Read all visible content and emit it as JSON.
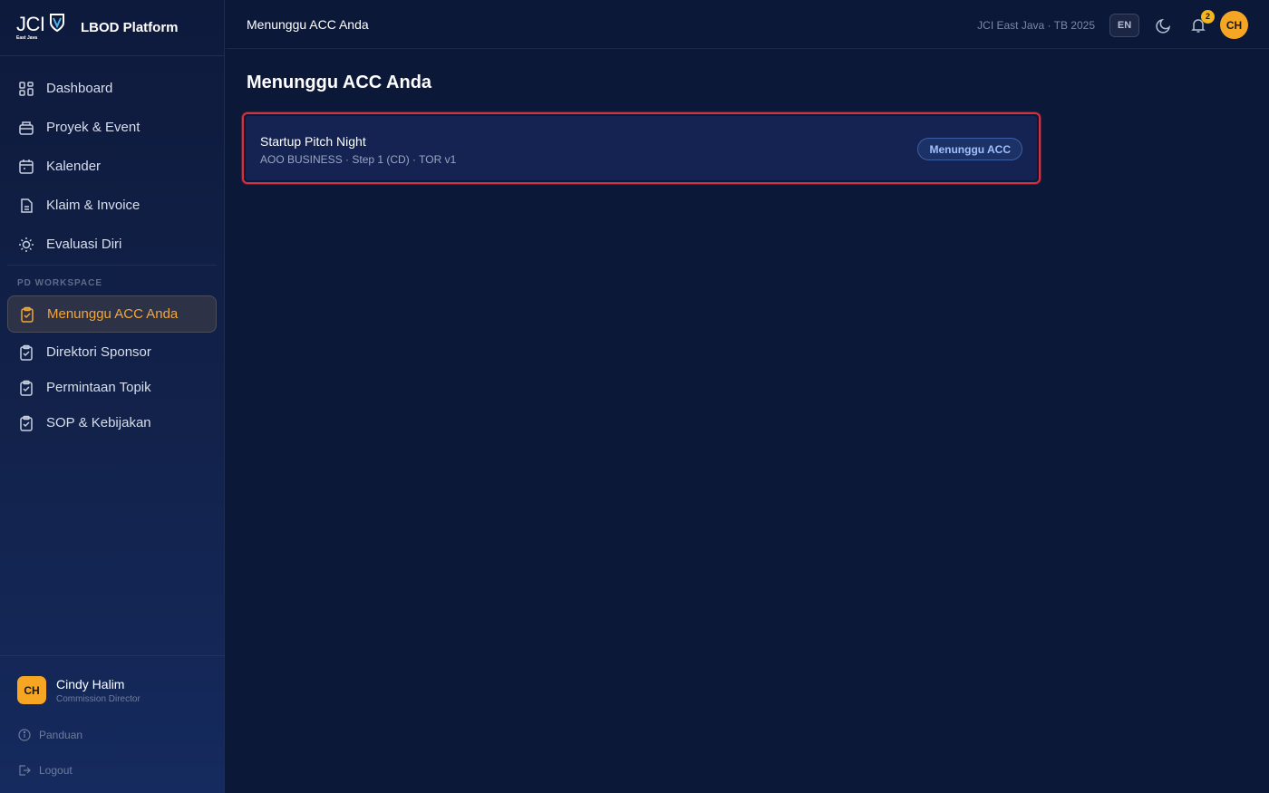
{
  "brand": {
    "logo_text": "JCI",
    "logo_sub": "East Java",
    "title": "LBOD Platform"
  },
  "sidebar": {
    "items": [
      {
        "label": "Dashboard",
        "icon": "grid-icon"
      },
      {
        "label": "Proyek & Event",
        "icon": "briefcase-icon"
      },
      {
        "label": "Kalender",
        "icon": "calendar-icon"
      },
      {
        "label": "Klaim & Invoice",
        "icon": "document-icon"
      },
      {
        "label": "Evaluasi Diri",
        "icon": "lightbulb-icon"
      }
    ],
    "section_label": "PD WORKSPACE",
    "pd_items": [
      {
        "label": "Menunggu ACC Anda",
        "icon": "clipboard-check-icon",
        "active": true
      },
      {
        "label": "Direktori Sponsor",
        "icon": "clipboard-check-icon"
      },
      {
        "label": "Permintaan Topik",
        "icon": "clipboard-check-icon"
      },
      {
        "label": "SOP & Kebijakan",
        "icon": "clipboard-check-icon"
      }
    ],
    "active_color": "#f2a63a"
  },
  "user": {
    "initials": "CH",
    "name": "Cindy Halim",
    "role": "Commission Director",
    "help_label": "Panduan",
    "logout_label": "Logout"
  },
  "topbar": {
    "title": "Menunggu ACC Anda",
    "org": "JCI East Java · TB 2025",
    "lang": "EN",
    "notif_count": "2",
    "avatar_initials": "CH"
  },
  "main": {
    "title": "Menunggu ACC Anda",
    "cards": [
      {
        "title": "Startup Pitch Night",
        "meta": "AOO BUSINESS · Step 1 (CD) · TOR v1",
        "status": "Menunggu ACC"
      }
    ]
  },
  "colors": {
    "background": "#0c1838",
    "accent": "#f6a623",
    "highlight_border": "#d6313e",
    "status_text": "#9fc0ff"
  }
}
